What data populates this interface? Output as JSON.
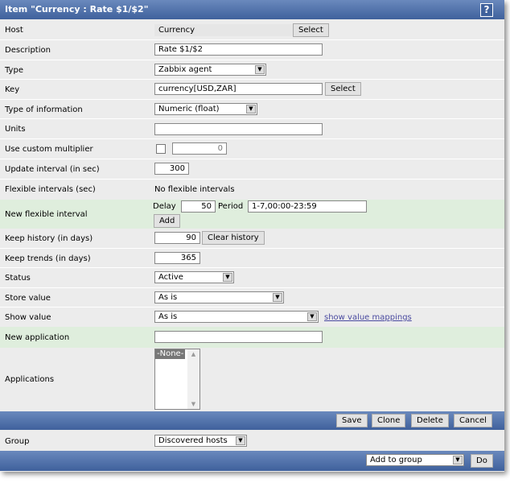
{
  "title": "Item \"Currency : Rate $1/$2\"",
  "help_label": "?",
  "fields": {
    "host": {
      "label": "Host",
      "value": "Currency",
      "button": "Select"
    },
    "description": {
      "label": "Description",
      "value": "Rate $1/$2"
    },
    "type": {
      "label": "Type",
      "value": "Zabbix agent"
    },
    "key": {
      "label": "Key",
      "value": "currency[USD,ZAR]",
      "button": "Select"
    },
    "type_of_information": {
      "label": "Type of information",
      "value": "Numeric (float)"
    },
    "units": {
      "label": "Units",
      "value": ""
    },
    "custom_multiplier": {
      "label": "Use custom multiplier",
      "checked": false,
      "value": "0"
    },
    "update_interval": {
      "label": "Update interval (in sec)",
      "value": "300"
    },
    "flexible_intervals": {
      "label": "Flexible intervals (sec)",
      "value": "No flexible intervals"
    },
    "new_flexible_interval": {
      "label": "New flexible interval",
      "delay_label": "Delay",
      "delay": "50",
      "period_label": "Period",
      "period": "1-7,00:00-23:59",
      "add": "Add"
    },
    "keep_history": {
      "label": "Keep history (in days)",
      "value": "90",
      "button": "Clear history"
    },
    "keep_trends": {
      "label": "Keep trends (in days)",
      "value": "365"
    },
    "status": {
      "label": "Status",
      "value": "Active"
    },
    "store_value": {
      "label": "Store value",
      "value": "As is"
    },
    "show_value": {
      "label": "Show value",
      "value": "As is",
      "link": "show value mappings"
    },
    "new_application": {
      "label": "New application",
      "value": ""
    },
    "applications": {
      "label": "Applications",
      "options": [
        "-None-"
      ]
    }
  },
  "actions": {
    "save": "Save",
    "clone": "Clone",
    "delete": "Delete",
    "cancel": "Cancel"
  },
  "group": {
    "label": "Group",
    "value": "Discovered hosts"
  },
  "footer": {
    "action": "Add to group",
    "do": "Do"
  }
}
